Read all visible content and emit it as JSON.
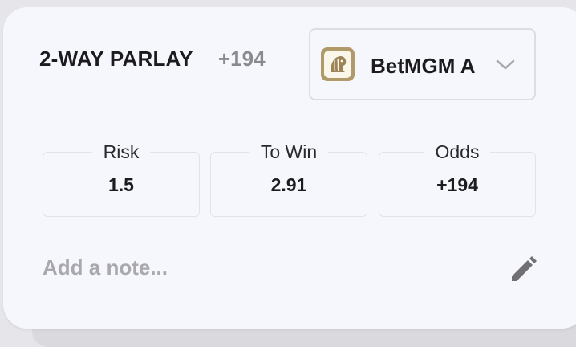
{
  "bet": {
    "title": "2-WAY PARLAY",
    "odds": "+194"
  },
  "sportsbook": {
    "name": "BetMGM A",
    "icon": "betmgm-lion-logo",
    "dropdown_icon": "chevron-down-icon"
  },
  "fields": [
    {
      "label": "Risk",
      "value": "1.5"
    },
    {
      "label": "To Win",
      "value": "2.91"
    },
    {
      "label": "Odds",
      "value": "+194"
    }
  ],
  "note": {
    "placeholder": "Add a note...",
    "edit_icon": "pencil-icon"
  },
  "colors": {
    "card_background": "#f6f7fc",
    "logo_gold": "#b19a6a",
    "muted_text": "#8a8a8e"
  }
}
